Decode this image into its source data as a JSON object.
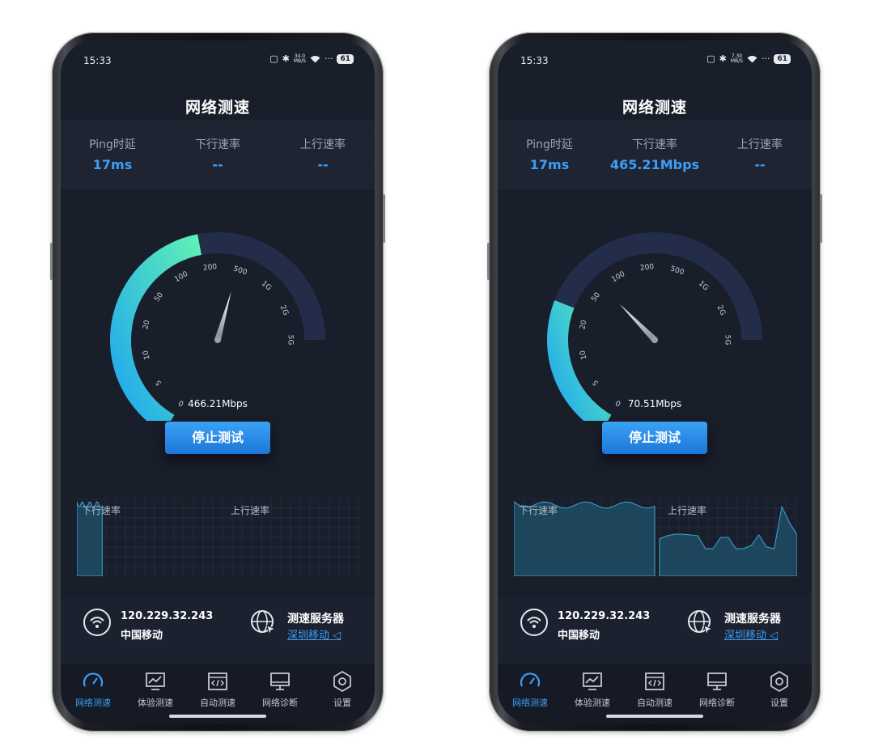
{
  "brand_color": "#3c9ef6",
  "phones": [
    {
      "status": {
        "time": "15:33",
        "net_speed": "34.0",
        "net_unit": "MB/S",
        "battery": "61"
      },
      "title": "网络测速",
      "stats": [
        {
          "label": "Ping时延",
          "value": "17ms"
        },
        {
          "label": "下行速率",
          "value": "--"
        },
        {
          "label": "上行速率",
          "value": "--"
        }
      ],
      "gauge": {
        "ticks": [
          "0",
          "5",
          "10",
          "20",
          "50",
          "100",
          "200",
          "500",
          "1G",
          "2G",
          "5G"
        ],
        "readout": "466.21Mbps",
        "fill_fraction": 0.58,
        "needle_fraction": 0.69
      },
      "stop_label": "停止测试",
      "charts": {
        "down_label": "下行速率",
        "up_label": "上行速率",
        "down_fill": 0.18,
        "up_fill": 0
      },
      "info": {
        "ip": "120.229.32.243",
        "carrier": "中国移动",
        "server_title": "测速服务器",
        "server_name": "深圳移动"
      },
      "nav": [
        {
          "label": "网络测速",
          "icon": "speedometer-icon",
          "active": true
        },
        {
          "label": "体验测速",
          "icon": "monitor-chart-icon",
          "active": false
        },
        {
          "label": "自动测速",
          "icon": "code-window-icon",
          "active": false
        },
        {
          "label": "网络诊断",
          "icon": "desktop-icon",
          "active": false
        },
        {
          "label": "设置",
          "icon": "settings-hexagon-icon",
          "active": false
        }
      ]
    },
    {
      "status": {
        "time": "15:33",
        "net_speed": "7.30",
        "net_unit": "MB/S",
        "battery": "61"
      },
      "title": "网络测速",
      "stats": [
        {
          "label": "Ping时延",
          "value": "17ms"
        },
        {
          "label": "下行速率",
          "value": "465.21Mbps"
        },
        {
          "label": "上行速率",
          "value": "--"
        }
      ],
      "gauge": {
        "ticks": [
          "0",
          "5",
          "10",
          "20",
          "50",
          "100",
          "200",
          "500",
          "1G",
          "2G",
          "5G"
        ],
        "readout": "70.51Mbps",
        "fill_fraction": 0.34,
        "needle_fraction": 0.44
      },
      "stop_label": "停止测试",
      "charts": {
        "down_label": "下行速率",
        "up_label": "上行速率",
        "down_fill": 1.0,
        "up_fill": 1.0
      },
      "info": {
        "ip": "120.229.32.243",
        "carrier": "中国移动",
        "server_title": "测速服务器",
        "server_name": "深圳移动"
      },
      "nav": [
        {
          "label": "网络测速",
          "icon": "speedometer-icon",
          "active": true
        },
        {
          "label": "体验测速",
          "icon": "monitor-chart-icon",
          "active": false
        },
        {
          "label": "自动测速",
          "icon": "code-window-icon",
          "active": false
        },
        {
          "label": "网络诊断",
          "icon": "desktop-icon",
          "active": false
        },
        {
          "label": "设置",
          "icon": "settings-hexagon-icon",
          "active": false
        }
      ]
    }
  ]
}
